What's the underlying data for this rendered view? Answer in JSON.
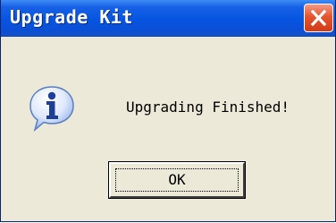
{
  "window": {
    "title": "Upgrade Kit",
    "close_icon": "close-icon",
    "accent_color": "#0655e0",
    "close_color": "#e5552f"
  },
  "dialog": {
    "icon": "info-icon",
    "message": "Upgrading Finished!",
    "ok_label": "OK"
  }
}
